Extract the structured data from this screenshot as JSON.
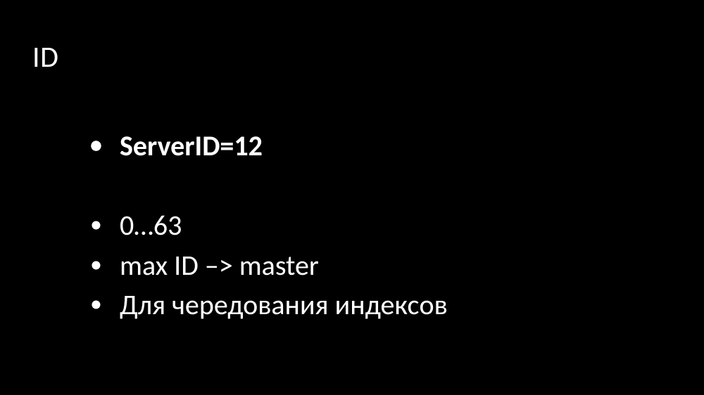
{
  "slide": {
    "title": "ID",
    "bullets": [
      {
        "text": "ServerID=12",
        "bold": true
      },
      {
        "text": "0…63",
        "bold": false
      },
      {
        "text": "max ID –> master",
        "bold": false
      },
      {
        "text": "Для чередования индексов",
        "bold": false
      }
    ]
  }
}
